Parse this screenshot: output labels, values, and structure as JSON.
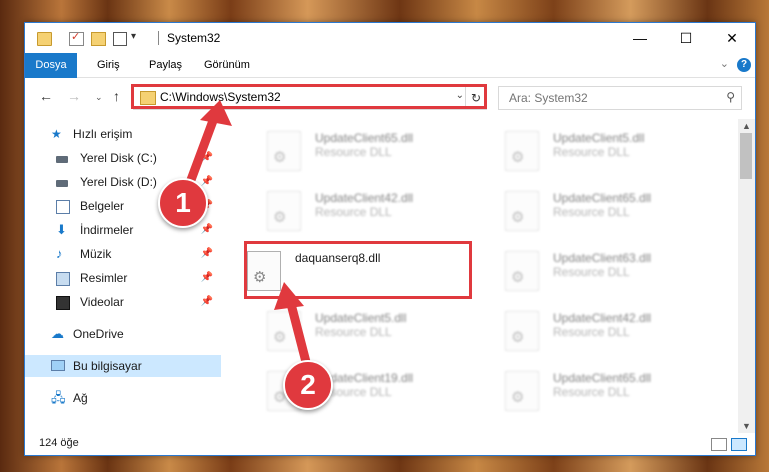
{
  "window": {
    "title": "System32",
    "minimize": "—",
    "maximize": "☐",
    "close": "✕"
  },
  "ribbon": {
    "tabs": [
      "Dosya",
      "Giriş",
      "Paylaş",
      "Görünüm"
    ]
  },
  "nav": {
    "back": "←",
    "forward": "→",
    "recent": "⌄",
    "up": "↑",
    "address": "C:\\Windows\\System32",
    "refresh": "↻",
    "search_placeholder": "Ara: System32"
  },
  "sidebar": {
    "quick_access": "Hızlı erişim",
    "items": [
      {
        "label": "Yerel Disk (C:)"
      },
      {
        "label": "Yerel Disk (D:)"
      },
      {
        "label": "Belgeler"
      },
      {
        "label": "İndirmeler"
      },
      {
        "label": "Müzik"
      },
      {
        "label": "Resimler"
      },
      {
        "label": "Videolar"
      }
    ],
    "onedrive": "OneDrive",
    "this_pc": "Bu bilgisayar",
    "network": "Ağ"
  },
  "files": [
    {
      "name": "UpdateClient65.dll",
      "desc": "Resource DLL"
    },
    {
      "name": "UpdateClient5.dll",
      "desc": "Resource DLL"
    },
    {
      "name": "UpdateClient42.dll",
      "desc": "Resource DLL"
    },
    {
      "name": "UpdateClient65.dll",
      "desc": "Resource DLL"
    },
    {
      "name": "daquanserq8.dll",
      "desc": ""
    },
    {
      "name": "UpdateClient63.dll",
      "desc": "Resource DLL"
    },
    {
      "name": "UpdateClient5.dll",
      "desc": "Resource DLL"
    },
    {
      "name": "UpdateClient42.dll",
      "desc": "Resource DLL"
    },
    {
      "name": "UpdateClient19.dll",
      "desc": "Resource DLL"
    },
    {
      "name": "UpdateClient65.dll",
      "desc": "Resource DLL"
    }
  ],
  "status": {
    "count": "124 öğe"
  },
  "annotations": {
    "callout1": "1",
    "callout2": "2",
    "color": "#e0393e"
  }
}
